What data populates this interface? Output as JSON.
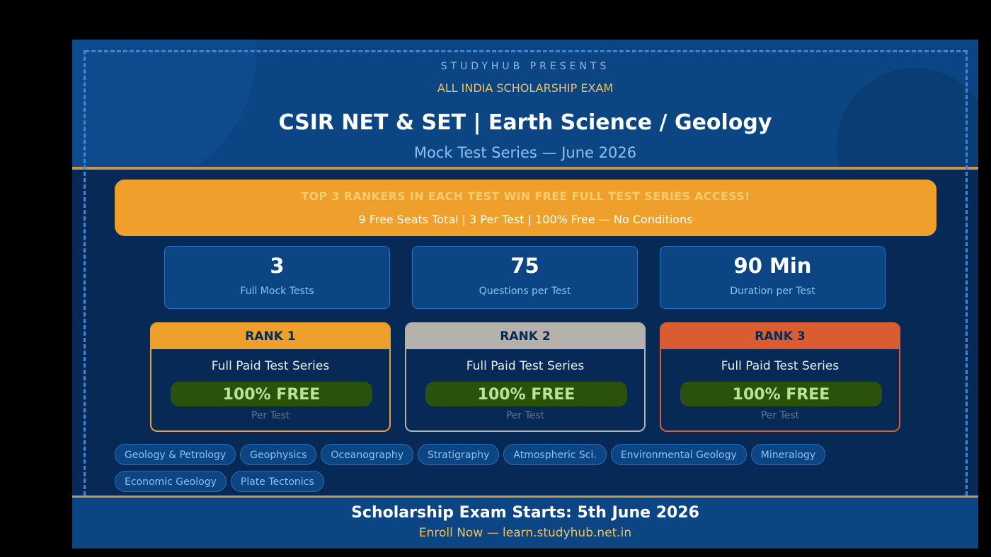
{
  "header": {
    "presents": "STUDYHUB PRESENTS",
    "exam_title": "ALL INDIA SCHOLARSHIP EXAM",
    "main_title": "CSIR NET & SET  |  Earth Science / Geology",
    "subtitle": "Mock Test Series  —  June 2026"
  },
  "promo": {
    "headline": "TOP 3 RANKERS IN EACH TEST WIN FREE FULL TEST SERIES ACCESS!",
    "details": "9 Free Seats Total  |  3 Per Test  |  100% Free — No Conditions"
  },
  "stats": [
    {
      "value": "3",
      "label": "Full Mock Tests"
    },
    {
      "value": "75",
      "label": "Questions per Test"
    },
    {
      "value": "90 Min",
      "label": "Duration per Test"
    }
  ],
  "ranks": [
    {
      "title": "RANK 1",
      "prize": "Full Paid Test Series",
      "badge": "100% FREE",
      "note": "Per Test",
      "color": "#ee9f2c"
    },
    {
      "title": "RANK 2",
      "prize": "Full Paid Test Series",
      "badge": "100% FREE",
      "note": "Per Test",
      "color": "#b5b2ab"
    },
    {
      "title": "RANK 3",
      "prize": "Full Paid Test Series",
      "badge": "100% FREE",
      "note": "Per Test",
      "color": "#d95d31"
    }
  ],
  "subjects": [
    "Geology & Petrology",
    "Geophysics",
    "Oceanography",
    "Stratigraphy",
    "Atmospheric Sci.",
    "Environmental Geology",
    "Mineralogy",
    "Economic Geology",
    "Plate Tectonics"
  ],
  "footer": {
    "title": "Scholarship Exam Starts:  5th June 2026",
    "enroll": "Enroll Now  —  learn.studyhub.net.in"
  },
  "colors": {
    "background": "#062a55",
    "header": "#0b4584",
    "accent_gold": "#ee9f2c",
    "badge_green": "#2a520c"
  }
}
